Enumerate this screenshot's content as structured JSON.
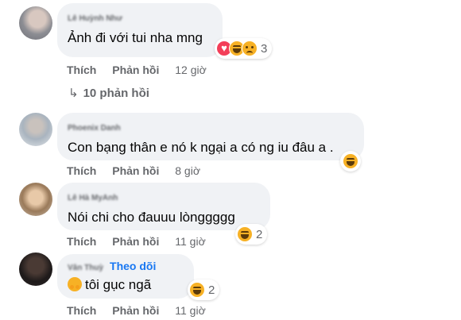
{
  "comments": [
    {
      "author": "Lê Huỳnh Như",
      "text": "Ảnh đi với tui nha mng",
      "actions": {
        "like": "Thích",
        "reply": "Phản hồi",
        "time": "12 giờ"
      },
      "reactions": {
        "icons": [
          "heart-icon",
          "haha-icon",
          "sad-icon"
        ],
        "count": "3"
      },
      "replies_label": "10 phản hồi"
    },
    {
      "author": "Phoenix Danh",
      "text": "Con bạng thân e nó k ngại a có ng iu đâu a .",
      "actions": {
        "like": "Thích",
        "reply": "Phản hồi",
        "time": "8 giờ"
      },
      "reactions": {
        "icons": [
          "haha-icon"
        ],
        "count": ""
      }
    },
    {
      "author": "Lê Hà MyAnh",
      "text": "Nói chi cho đauuu lònggggg",
      "actions": {
        "like": "Thích",
        "reply": "Phản hồi",
        "time": "11 giờ"
      },
      "reactions": {
        "icons": [
          "haha-icon"
        ],
        "count": "2"
      }
    },
    {
      "author": "Vân Thuỳ",
      "follow": "Theo dõi",
      "text": "tôi gục ngã",
      "actions": {
        "like": "Thích",
        "reply": "Phản hồi",
        "time": "11 giờ"
      },
      "reactions": {
        "icons": [
          "haha-icon"
        ],
        "count": "2"
      }
    }
  ],
  "colors": {
    "bubble": "#f0f2f5",
    "secondary_text": "#65676b",
    "link": "#1877f2",
    "reaction_yellow": "#f7b125",
    "love_red": "#f33e58"
  }
}
